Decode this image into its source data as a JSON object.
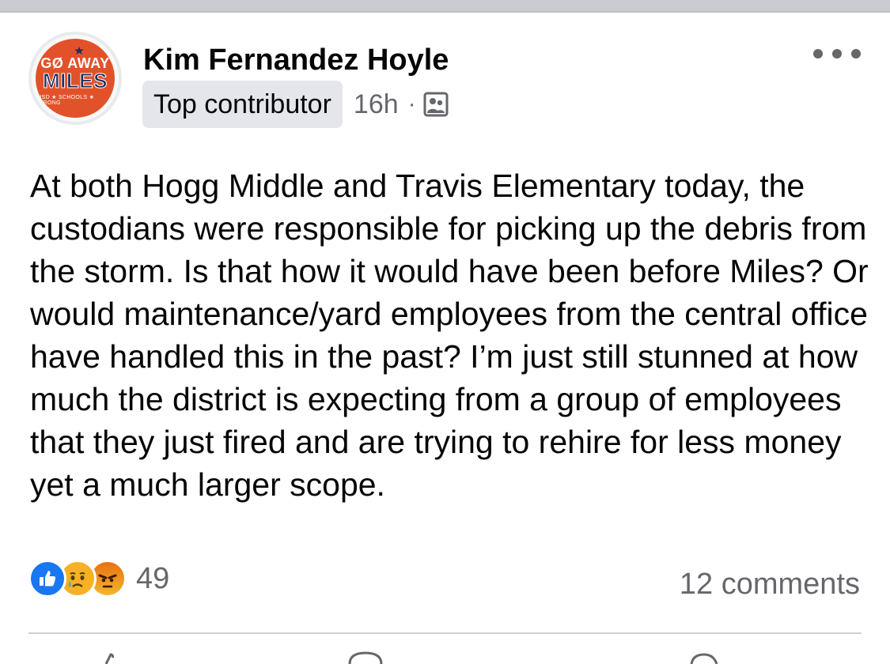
{
  "post": {
    "author": "Kim Fernandez Hoyle",
    "badge": "Top contributor",
    "timestamp": "16h",
    "separator": "·",
    "avatar_logo": {
      "top_text": "GØ AWAY",
      "main_text": "MILES",
      "bottom_text": "HISD ★ SCHOOLS ★ STRONG"
    },
    "body": "At both Hogg Middle and Travis Elementary today, the custodians were responsible for picking up the debris from the storm. Is that how it would have been before Miles? Or would maintenance/yard employees from the central office have handled this in the past? I’m just still stunned at how much the district is expecting from a group of employees that they just fired and are trying to rehire for less money yet a much larger scope.",
    "reactions": {
      "types": [
        "like-icon",
        "sad-icon",
        "angry-icon"
      ],
      "count": "49"
    },
    "comments": "12 comments"
  },
  "colors": {
    "like": "#1877f2",
    "sad": "#f7b125",
    "angry": "#e9710f",
    "secondary_text": "#65676b",
    "badge_bg": "#e4e6eb",
    "logo_orange": "#e2522a",
    "logo_navy": "#1f2d5c"
  }
}
